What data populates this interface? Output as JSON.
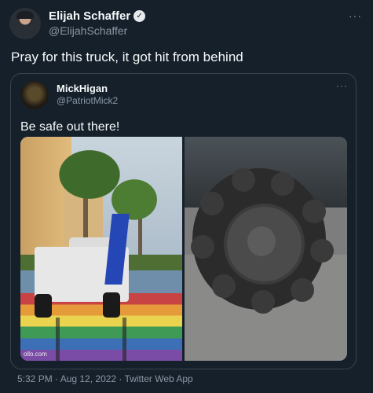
{
  "tweet": {
    "author_name": "Elijah Schaffer",
    "handle": "@ElijahSchaffer",
    "text": "Pray for this truck, it got hit from behind",
    "more_label": "···",
    "verified_mark": "✓",
    "timestamp": "5:32 PM · Aug 12, 2022 · Twitter Web App"
  },
  "quote": {
    "author_name": "MickHigan",
    "handle": "@PatriotMick2",
    "text": "Be safe out there!",
    "more_label": "···",
    "image_watermark": "ollo.com"
  },
  "icons": {
    "verified": "verified-badge-icon",
    "more": "more-options-icon"
  },
  "colors": {
    "background": "#15202b",
    "border": "#38444d",
    "secondary_text": "#8b98a5",
    "primary_text": "#f7f9f9"
  }
}
